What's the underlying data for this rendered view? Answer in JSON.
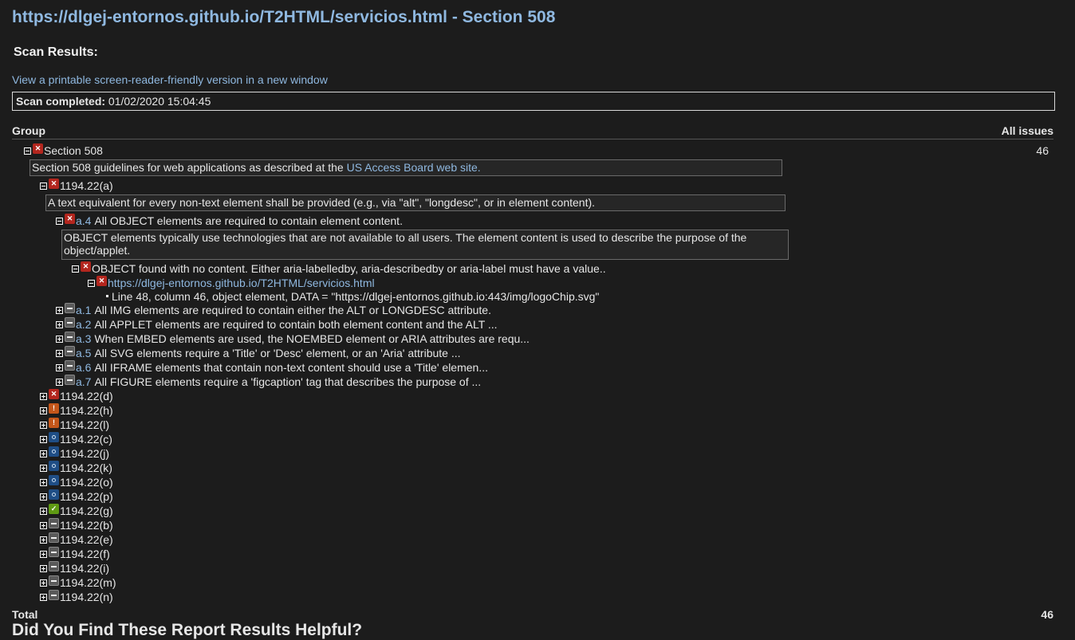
{
  "page_title": "https://dlgej-entornos.github.io/T2HTML/servicios.html - Section 508",
  "scan_heading": "Scan Results:",
  "printable_link": "View a printable screen-reader-friendly version in a new window",
  "scan": {
    "label": "Scan completed:",
    "value": "01/02/2020 15:04:45"
  },
  "table": {
    "group_header": "Group",
    "issues_header": "All issues"
  },
  "section": {
    "label": "Section 508",
    "count": "46",
    "desc_prefix": "Section 508 guidelines for web applications as described at the",
    "desc_link": "US Access Board web site."
  },
  "a_group": {
    "label": "1194.22(a)",
    "desc": "A text equivalent for every non-text element shall be provided (e.g., via \"alt\", \"longdesc\", or in element content)."
  },
  "a4": {
    "code": "a.4",
    "text": "All OBJECT elements are required to contain element content.",
    "desc": "OBJECT elements typically use technologies that are not available to all users. The element content is used to describe the purpose of the object/applet.",
    "finding": "OBJECT found with no content. Either aria-labelledby, aria-describedby or aria-label must have a value..",
    "url": "https://dlgej-entornos.github.io/T2HTML/servicios.html",
    "detail": "Line 48, column 46, object element, DATA = \"https://dlgej-entornos.github.io:443/img/logoChip.svg\""
  },
  "rules": [
    {
      "code": "a.1",
      "text": "All IMG elements are required to contain either the ALT or LONGDESC attribute."
    },
    {
      "code": "a.2",
      "text": "All APPLET elements are required to contain both element content and the ALT ..."
    },
    {
      "code": "a.3",
      "text": "When EMBED elements are used, the NOEMBED element or ARIA attributes are requ..."
    },
    {
      "code": "a.5",
      "text": "All SVG elements require a 'Title' or 'Desc' element, or an 'Aria' attribute ..."
    },
    {
      "code": "a.6",
      "text": "All IFRAME elements that contain non-text content should use a 'Title' elemen..."
    },
    {
      "code": "a.7",
      "text": "All FIGURE elements require a 'figcaption' tag that describes the purpose of ..."
    }
  ],
  "groups": [
    {
      "label": "1194.22(d)",
      "status": "error"
    },
    {
      "label": "1194.22(h)",
      "status": "warning"
    },
    {
      "label": "1194.22(l)",
      "status": "warning"
    },
    {
      "label": "1194.22(c)",
      "status": "info"
    },
    {
      "label": "1194.22(j)",
      "status": "info"
    },
    {
      "label": "1194.22(k)",
      "status": "info"
    },
    {
      "label": "1194.22(o)",
      "status": "info"
    },
    {
      "label": "1194.22(p)",
      "status": "info"
    },
    {
      "label": "1194.22(g)",
      "status": "pass"
    },
    {
      "label": "1194.22(b)",
      "status": "na"
    },
    {
      "label": "1194.22(e)",
      "status": "na"
    },
    {
      "label": "1194.22(f)",
      "status": "na"
    },
    {
      "label": "1194.22(i)",
      "status": "na"
    },
    {
      "label": "1194.22(m)",
      "status": "na"
    },
    {
      "label": "1194.22(n)",
      "status": "na"
    }
  ],
  "total": {
    "label": "Total",
    "value": "46"
  },
  "feedback_heading": "Did You Find These Report Results Helpful?"
}
